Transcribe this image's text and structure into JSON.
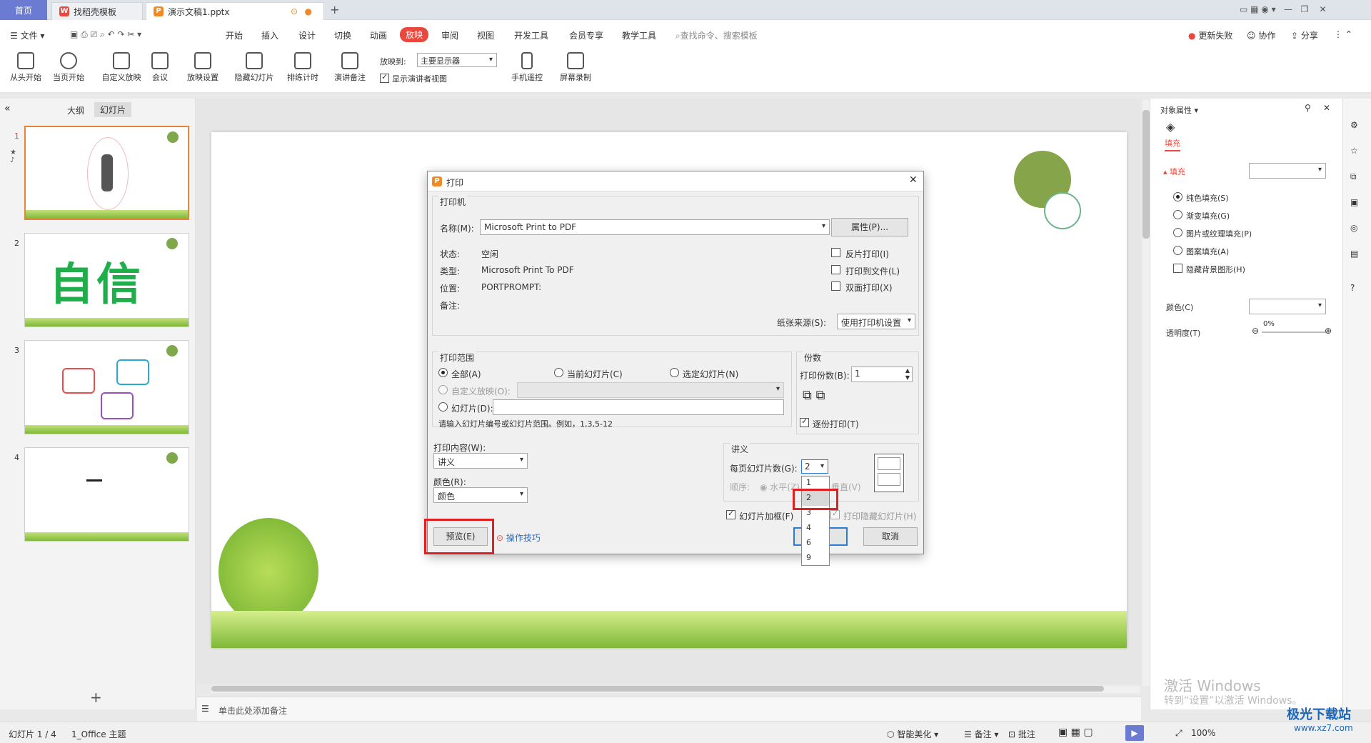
{
  "tabs": {
    "home": "首页",
    "template": "找稻壳模板",
    "doc": "演示文稿1.pptx"
  },
  "menu": {
    "file": "文件",
    "items": [
      "开始",
      "插入",
      "设计",
      "切换",
      "动画",
      "放映",
      "审阅",
      "视图",
      "开发工具",
      "会员专享",
      "教学工具"
    ],
    "search": "查找命令、搜索模板",
    "update_fail": "更新失败",
    "collab": "协作",
    "share": "分享"
  },
  "ribbon": {
    "from_start": "从头开始",
    "from_current": "当页开始",
    "custom_show": "自定义放映",
    "meeting": "会议",
    "show_settings": "放映设置",
    "hide_slide": "隐藏幻灯片",
    "rehearse": "排练计时",
    "speaker_notes": "演讲备注",
    "show_to_label": "放映到:",
    "show_to_value": "主要显示器",
    "presenter_view": "显示演讲者视图",
    "phone_remote": "手机遥控",
    "screen_record": "屏幕录制"
  },
  "leftpanel": {
    "outline": "大纲",
    "slides": "幻灯片",
    "thumb2_text": "自信"
  },
  "dialog": {
    "title": "打印",
    "printer_group": "打印机",
    "name_label": "名称(M):",
    "name_value": "Microsoft Print to PDF",
    "properties": "属性(P)...",
    "status_label": "状态:",
    "status_value": "空闲",
    "type_label": "类型:",
    "type_value": "Microsoft Print To PDF",
    "location_label": "位置:",
    "location_value": "PORTPROMPT:",
    "comment_label": "备注:",
    "reverse": "反片打印(I)",
    "to_file": "打印到文件(L)",
    "duplex": "双面打印(X)",
    "paper_source_label": "纸张来源(S):",
    "paper_source_value": "使用打印机设置",
    "range_group": "打印范围",
    "all": "全部(A)",
    "current": "当前幻灯片(C)",
    "selected": "选定幻灯片(N)",
    "custom": "自定义放映(O):",
    "slides": "幻灯片(D):",
    "range_hint": "请输入幻灯片编号或幻灯片范围。例如，1,3,5-12",
    "copies_group": "份数",
    "copies_label": "打印份数(B):",
    "copies_value": "1",
    "collate": "逐份打印(T)",
    "content_label": "打印内容(W):",
    "content_value": "讲义",
    "color_label": "颜色(R):",
    "color_value": "颜色",
    "handout_group": "讲义",
    "per_page_label": "每页幻灯片数(G):",
    "per_page_value": "2",
    "order_label": "顺序:",
    "horizontal": "水平(Z)",
    "vertical": "垂直(V)",
    "frame": "幻灯片加框(F)",
    "print_hidden": "打印隐藏幻灯片(H)",
    "preview": "预览(E)",
    "tips": "操作技巧",
    "ok": "确定",
    "cancel": "取消",
    "dropdown_options": [
      "1",
      "2",
      "3",
      "4",
      "6",
      "9"
    ]
  },
  "rightpanel": {
    "title": "对象属性",
    "tab_fill": "填充",
    "fill_section": "填充",
    "solid": "纯色填充(S)",
    "gradient": "渐变填充(G)",
    "picture": "图片或纹理填充(P)",
    "pattern": "图案填充(A)",
    "hide_bg": "隐藏背景图形(H)",
    "color": "颜色(C)",
    "transparency": "透明度(T)",
    "transparency_value": "0%"
  },
  "notes": {
    "placeholder": "单击此处添加备注"
  },
  "status": {
    "slide": "幻灯片 1 / 4",
    "theme": "1_Office 主题",
    "beautify": "智能美化",
    "notes": "备注",
    "comment": "批注",
    "zoom": "100%"
  },
  "watermark": {
    "win1": "激活 Windows",
    "win2": "转到“设置”以激活 Windows。",
    "site": "极光下载站",
    "url": "www.xz7.com"
  },
  "colors": {
    "accent": "#e8483e",
    "home_tab": "#6a7bd1",
    "highlight": "#e02020",
    "green": "#7fa84a"
  }
}
